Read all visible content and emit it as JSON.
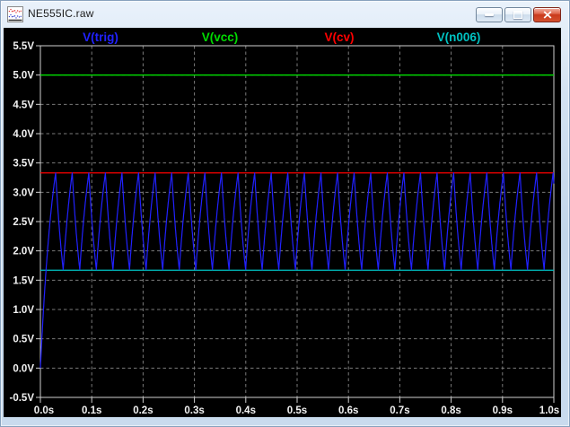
{
  "window": {
    "title": "NE555IC.raw",
    "controls": {
      "minimize_label": "Minimize",
      "maximize_label": "Maximize",
      "close_label": "Close"
    }
  },
  "icons": {
    "app": "waveform-plot-icon (red and blue dotted traces on white)",
    "minimize": "horizontal-bar",
    "maximize": "square-outline",
    "close": "x-cross"
  },
  "colors": {
    "plot_background": "#000000",
    "grid": "#7a7a7a",
    "frame": "#cfcfcf",
    "tick_label": "#f2f2f2",
    "trace_trig": "#2121ff",
    "trace_vcc": "#00dc00",
    "trace_cv": "#ff0000",
    "trace_n006": "#00c2c2",
    "titlebar_text": "#1d1d1d",
    "close_button_red": "#c93a1c"
  },
  "chart_data": {
    "type": "line",
    "title": "",
    "xlabel": "",
    "ylabel": "",
    "x_axis": {
      "range": [
        0.0,
        1.0
      ],
      "tick_step": 0.1,
      "unit": "s",
      "tick_labels": [
        "0.0s",
        "0.1s",
        "0.2s",
        "0.3s",
        "0.4s",
        "0.5s",
        "0.6s",
        "0.7s",
        "0.8s",
        "0.9s",
        "1.0s"
      ]
    },
    "y_axis": {
      "range": [
        -0.5,
        5.5
      ],
      "tick_step": 0.5,
      "unit": "V",
      "tick_labels": [
        "5.5V",
        "5.0V",
        "4.5V",
        "4.0V",
        "3.5V",
        "3.0V",
        "2.5V",
        "2.0V",
        "1.5V",
        "1.0V",
        "0.5V",
        "0.0V",
        "-0.5V"
      ]
    },
    "grid": {
      "style": "dashed",
      "on": true
    },
    "legend_position": "top",
    "series": [
      {
        "name": "V(trig)",
        "color": "#2121ff",
        "shape": "relaxation-oscillator",
        "v_start": 0.0,
        "v_low": 1.68,
        "v_high": 3.33,
        "supply": 5.0,
        "t_first_peak": 0.0297,
        "t_fall": 0.0147,
        "t_rise": 0.0176,
        "t_end": 1.0,
        "description": "charges from 0V to 3.33V then oscillates as a triangle-like wave between 1.67V and 3.33V, ~31 cycles over 1s"
      },
      {
        "name": "V(vcc)",
        "color": "#00dc00",
        "shape": "constant",
        "value": 5.0
      },
      {
        "name": "V(cv)",
        "color": "#ff0000",
        "shape": "constant",
        "value": 3.33
      },
      {
        "name": "V(n006)",
        "color": "#00c2c2",
        "shape": "constant",
        "value": 1.67
      }
    ]
  }
}
